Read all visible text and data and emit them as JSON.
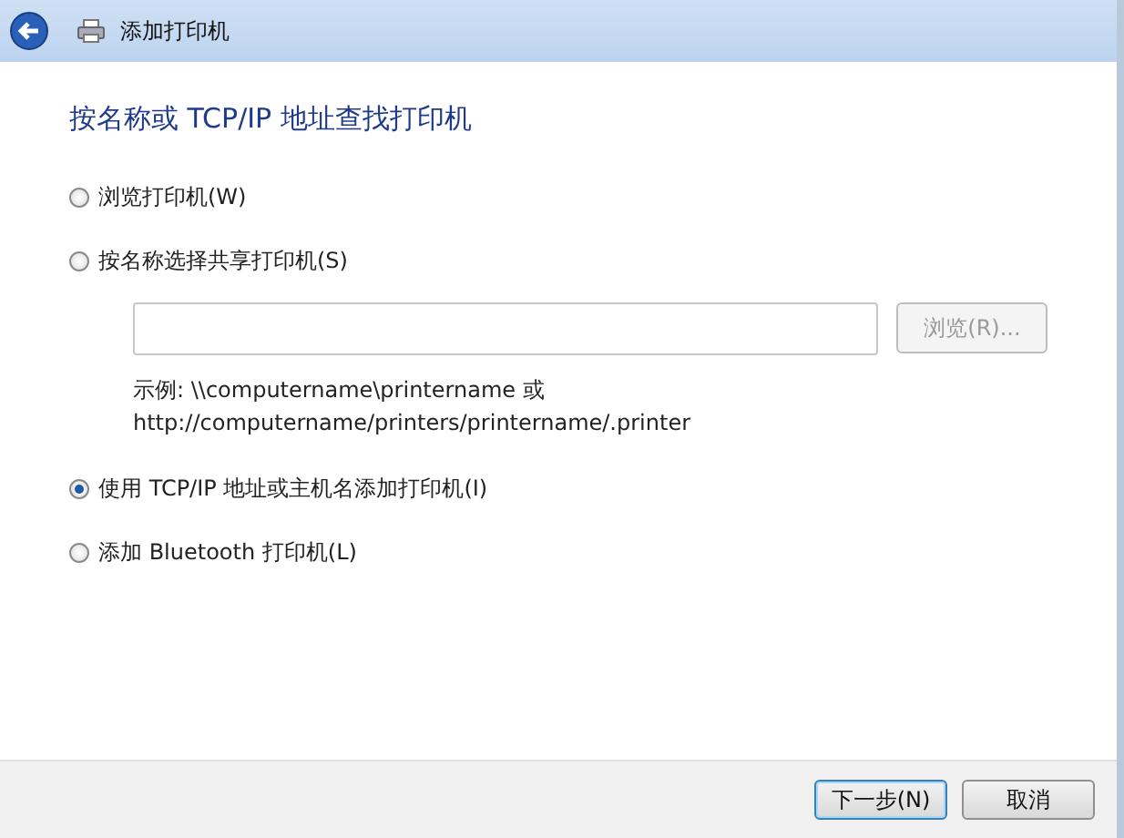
{
  "window": {
    "title": "添加打印机"
  },
  "heading": "按名称或 TCP/IP 地址查找打印机",
  "options": [
    {
      "kind": "plain",
      "label": "浏览打印机(W)",
      "selected": false
    },
    {
      "kind": "path",
      "label": "按名称选择共享打印机(S)",
      "selected": false,
      "browse_button": {
        "label": "浏览(R)...",
        "disabled": true
      },
      "example": [
        "示例: \\\\computername\\printername 或",
        "http://computername/printers/printername/.printer"
      ]
    },
    {
      "kind": "plain",
      "label": "使用 TCP/IP 地址或主机名添加打印机(I)",
      "selected": true
    },
    {
      "kind": "plain",
      "label": "添加 Bluetooth 打印机(L)",
      "selected": false
    }
  ],
  "buttons": [
    {
      "label": "下一步(N)",
      "default": true
    },
    {
      "label": "取消",
      "default": false
    }
  ]
}
